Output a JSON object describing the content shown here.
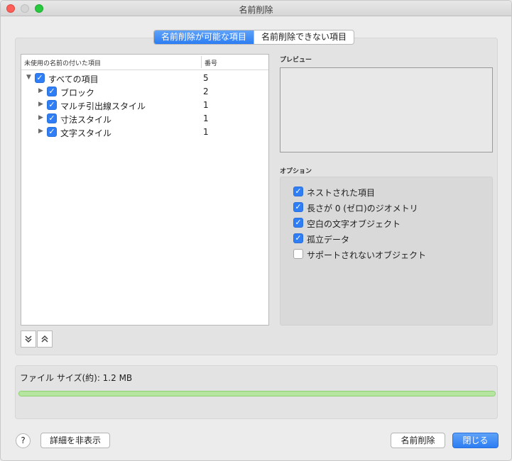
{
  "window": {
    "title": "名前削除"
  },
  "tabs": [
    {
      "label": "名前削除が可能な項目",
      "active": true
    },
    {
      "label": "名前削除できない項目",
      "active": false
    }
  ],
  "list": {
    "columns": [
      "未使用の名前の付いた項目",
      "番号"
    ],
    "rows": [
      {
        "label": "すべての項目",
        "count": "5",
        "checked": true,
        "expanded": true
      },
      {
        "label": "ブロック",
        "count": "2",
        "checked": true,
        "expanded": false
      },
      {
        "label": "マルチ引出線スタイル",
        "count": "1",
        "checked": true,
        "expanded": false
      },
      {
        "label": "寸法スタイル",
        "count": "1",
        "checked": true,
        "expanded": false
      },
      {
        "label": "文字スタイル",
        "count": "1",
        "checked": true,
        "expanded": false
      }
    ]
  },
  "preview": {
    "label": "プレビュー"
  },
  "options": {
    "label": "オプション",
    "items": [
      {
        "label": "ネストされた項目",
        "checked": true
      },
      {
        "label": "長さが 0 (ゼロ)のジオメトリ",
        "checked": true
      },
      {
        "label": "空白の文字オブジェクト",
        "checked": true
      },
      {
        "label": "孤立データ",
        "checked": true
      },
      {
        "label": "サポートされないオブジェクト",
        "checked": false
      }
    ]
  },
  "file": {
    "size_text": "ファイル サイズ(約): 1.2 MB",
    "progress": 1.0
  },
  "footer": {
    "help_label": "?",
    "details_label": "詳細を非表示",
    "purge_label": "名前削除",
    "close_label": "閉じる"
  },
  "colors": {
    "accent": "#2c7df3",
    "progress": "#b6e59f"
  },
  "icons": {
    "expand_all": "double-chevron-down-icon",
    "collapse_all": "double-chevron-up-icon",
    "check": "checkmark-icon"
  }
}
